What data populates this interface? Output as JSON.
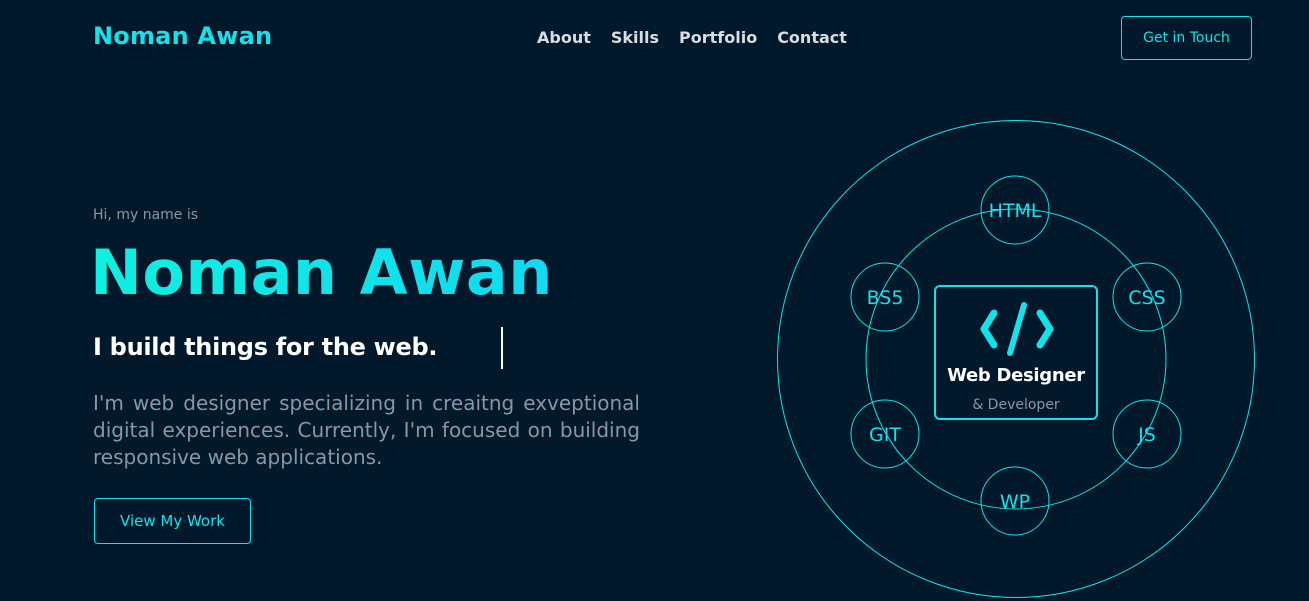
{
  "header": {
    "brand": "Noman Awan",
    "nav": [
      "About",
      "Skills",
      "Portfolio",
      "Contact"
    ],
    "cta": "Get in Touch"
  },
  "hero": {
    "greeting": "Hi, my name is",
    "name": "Noman Awan",
    "tagline": "I build things for the web.",
    "description": "I'm web designer specializing in creaitng exveptional digital experiences. Currently, I'm focused on building responsive web applications.",
    "cta": "View My Work"
  },
  "skills_orbit": {
    "center_title": "Web Designer",
    "center_subtitle": "& Developer",
    "center_icon": "code-icon",
    "nodes": [
      "HTML",
      "CSS",
      "JS",
      "WP",
      "GIT",
      "BS5"
    ]
  },
  "colors": {
    "background": "#02182b",
    "accent": "#12e3ea",
    "text_muted": "#8a96a5",
    "text_light": "#d7dde3"
  }
}
